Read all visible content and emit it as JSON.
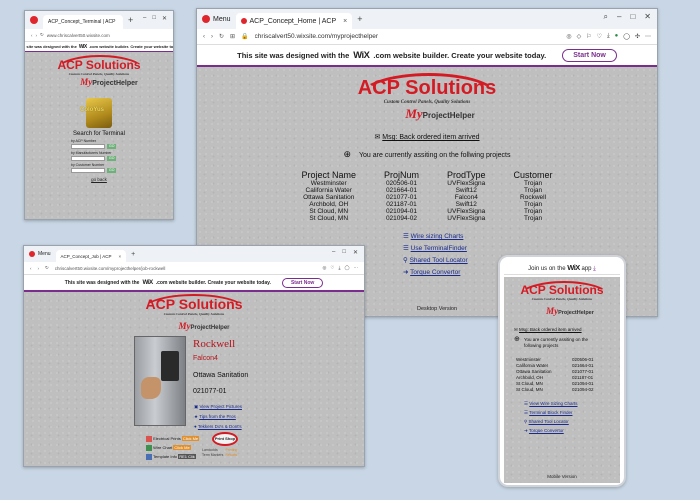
{
  "brand": {
    "name": "ACP Solutions",
    "tagline": "Custom Control Panels, Quality Solutions",
    "my": "My",
    "product": "ProjectHelper"
  },
  "wix": {
    "prefix": "This site was designed with the",
    "wix": "WiX",
    "suffix": ".com website builder. Create your website today.",
    "start": "Start Now",
    "mobile_prefix": "Join us on the",
    "mobile_wix": "WiX",
    "mobile_suffix": "app"
  },
  "browser": {
    "menu": "Menu",
    "new_tab": "+",
    "close": "×"
  },
  "win1": {
    "tab": "ACP_Concept_Terminal | ACP",
    "url": "www.chriscalvert50.wixsite.com",
    "search_title": "Search for Terminal",
    "fields": [
      {
        "label": "by ACP Number",
        "btn": "GO"
      },
      {
        "label": "by Manufacturers Number",
        "btn": "GO"
      },
      {
        "label": "by Customer Number",
        "btn": "GO"
      }
    ],
    "back": "go back",
    "image_caption": "ColoYus"
  },
  "win2": {
    "tab": "ACP_Concept_Home | ACP",
    "url": "chriscalvert50.wixsite.com/myprojecthelper",
    "msg": "Msg: Back ordered item arrived",
    "assisting": "You are currently assiting on the follwing projects",
    "headers": [
      "Project Name",
      "ProjNum",
      "ProdType",
      "Customer"
    ],
    "rows": [
      [
        "Westminster",
        "020506-01",
        "UVFlexSigna",
        "Trojan"
      ],
      [
        "California Water",
        "021664-01",
        "Swift12",
        "Trojan"
      ],
      [
        "Ottawa Sanitation",
        "021077-01",
        "Falcon4",
        "Rockwell"
      ],
      [
        "Archbold, OH",
        "021187-01",
        "Swift12",
        "Trojan"
      ],
      [
        "St Cloud, MN",
        "021094-01",
        "UVFlexSigna",
        "Trojan"
      ],
      [
        "St Cloud, MN",
        "021094-02",
        "UVFlexSigna",
        "Trojan"
      ]
    ],
    "links": [
      "Wire sizing Charts",
      "Use TerminalFinder",
      "Shared Tool Locator",
      "Torque Convertor"
    ],
    "footer": "Desktop Version"
  },
  "win3": {
    "tab": "ACP_Concept_Job | ACP",
    "url": "chriscalvert50.wixsite.com/myprojecthelper/job-rockwell",
    "customer": "Rockwell",
    "product": "Falcon4",
    "project": "Ottawa Sanitation",
    "projnum": "021077-01",
    "links": [
      "View Project Pictures",
      "Tips from the Pros",
      "Tekkers Do's & Dont's"
    ],
    "docs": [
      {
        "label": "Electrical Prints",
        "badge": "Click Me"
      },
      {
        "label": "Wire Chart",
        "badge": "Click Me"
      },
      {
        "label": "Template Info",
        "badge": "RE1 Clik"
      }
    ],
    "print_shop": "Print Shop",
    "print_items": [
      "Lamicoids",
      "Term Markers",
      "Printing",
      "Results"
    ]
  },
  "win4": {
    "msg": "Msg: Back ordered item arrived",
    "assisting": "You are currently assiting on the following projects",
    "rows": [
      [
        "Westminster",
        "020506-01"
      ],
      [
        "California Water",
        "021664-01"
      ],
      [
        "Ottawa Sanitation",
        "021077-01"
      ],
      [
        "Archbold, OH",
        "021187-01"
      ],
      [
        "St Cloud, MN",
        "021094-01"
      ],
      [
        "St Cloud, MN",
        "021094-02"
      ]
    ],
    "links": [
      "View Wire Sizing Charts",
      "Terminal Block Finder",
      "Shared Tool Locator",
      "Torque Convertor"
    ],
    "footer": "Mobile Version"
  },
  "colors": {
    "accent": "#d41b24",
    "wix_purple": "#7b2d8e",
    "link_blue": "#1a2b8c",
    "background": "#c8d6e5"
  }
}
